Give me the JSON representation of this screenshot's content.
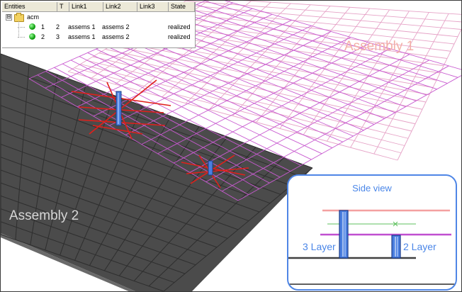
{
  "tree": {
    "columns": [
      "Entities",
      "T",
      "Link1",
      "Link2",
      "Link3",
      "State"
    ],
    "root_label": "acm",
    "expander": "⊟",
    "rows": [
      {
        "id": "1",
        "t": "2",
        "link1": "assems 1",
        "link2": "assems 2",
        "link3": "",
        "state": "realized"
      },
      {
        "id": "2",
        "t": "3",
        "link1": "assems 1",
        "link2": "assems 2",
        "link3": "",
        "state": "realized"
      }
    ]
  },
  "labels": {
    "assembly1": "Assembly 1",
    "assembly2": "Assembly 2"
  },
  "side_view": {
    "title": "Side view",
    "label_left": "3 Layer",
    "label_right": "2 Layer"
  },
  "colors": {
    "dark_plate": "#4b4b4b",
    "grid_pink": "#e6a3c7",
    "grid_magenta": "#c85ad0",
    "connector_red": "#e0201b",
    "connector_blue": "#4a7fe0",
    "accent_blue": "#4a86e8",
    "inset_pink": "#f4a0a0",
    "inset_magenta": "#c04fd0",
    "inset_green": "#5cc05c"
  }
}
